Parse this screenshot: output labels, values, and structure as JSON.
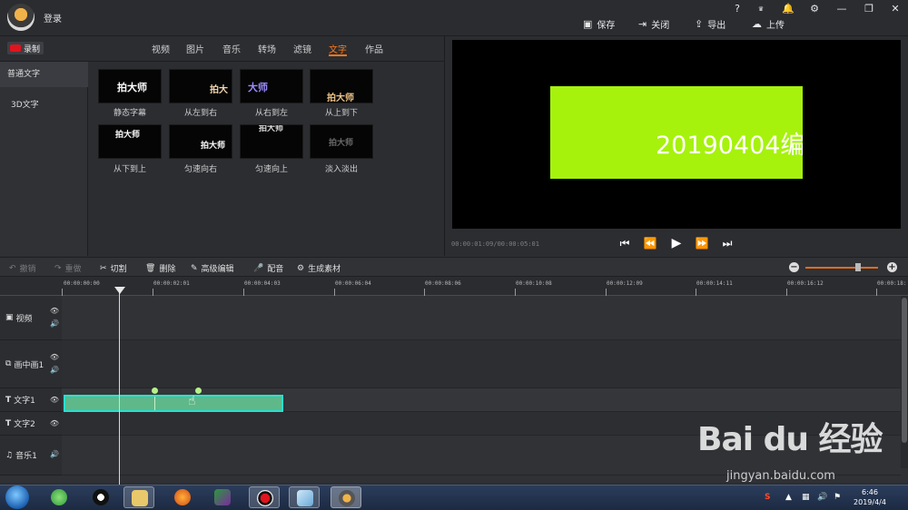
{
  "top": {
    "login": "登录",
    "save": "保存",
    "close": "关闭",
    "export": "导出",
    "upload": "上传",
    "help": "?",
    "vip": "VIP"
  },
  "record": "录制",
  "tabs": [
    "视频",
    "图片",
    "音乐",
    "转场",
    "滤镜",
    "文字",
    "作品"
  ],
  "active_tab": "文字",
  "sidebar": [
    "普通文字",
    "3D文字"
  ],
  "effects": [
    {
      "label": "静态字幕",
      "text": "拍大师"
    },
    {
      "label": "从左到右",
      "text": "拍大"
    },
    {
      "label": "从右到左",
      "text": "大师"
    },
    {
      "label": "从上到下",
      "text": "拍大师"
    },
    {
      "label": "从下到上",
      "text": "拍大师"
    },
    {
      "label": "匀速向右",
      "text": "拍大师"
    },
    {
      "label": "匀速向上",
      "text": "拍大师"
    },
    {
      "label": "淡入淡出",
      "text": "拍大师"
    }
  ],
  "preview": {
    "overlay_text": "20190404编",
    "timecode": "00:00:01:09/00:00:05:01"
  },
  "toolbar": {
    "undo": "撤销",
    "redo": "重做",
    "cut": "切割",
    "delete": "删除",
    "advanced": "高级编辑",
    "dub": "配音",
    "generate": "生成素材",
    "zoom_level": 0.72
  },
  "ruler": [
    "00:00:00:00",
    "00:00:02:01",
    "00:00:04:03",
    "00:00:06:04",
    "00:00:08:06",
    "00:00:10:08",
    "00:00:12:09",
    "00:00:14:11",
    "00:00:16:12",
    "00:00:18:"
  ],
  "tracks": [
    "视频",
    "画中画1",
    "文字1",
    "文字2",
    "音乐1"
  ],
  "taskbar": {
    "time": "6:46",
    "date": "2019/4/4"
  },
  "watermark": {
    "main": "Bai du 经验",
    "sub": "jingyan.baidu.com"
  },
  "colors": {
    "accent": "#ff7a1a",
    "clip": "#5fb889",
    "preview_box": "#a6f20c"
  }
}
